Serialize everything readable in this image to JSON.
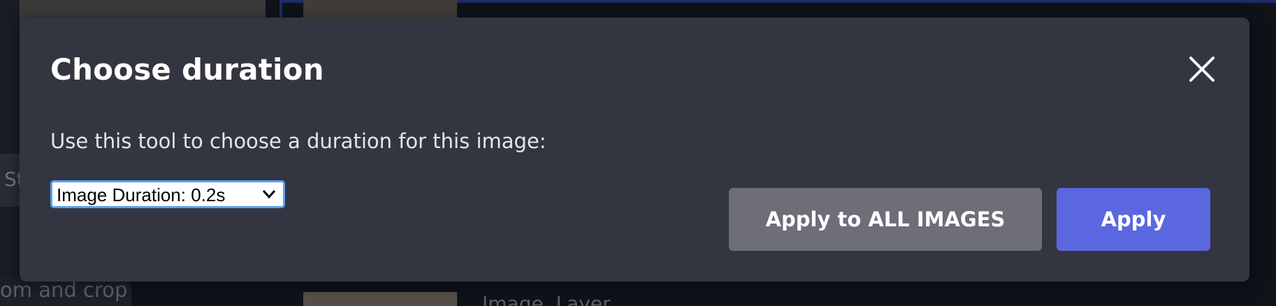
{
  "background": {
    "side_text": "St",
    "bottom_left_text": "om and crop",
    "bottom_label_text": "Image, Layer"
  },
  "modal": {
    "title": "Choose duration",
    "description": "Use this tool to choose a duration for this image:",
    "close_icon": "close-icon",
    "select": {
      "selected_value": "Image Duration: 0.2s"
    },
    "buttons": {
      "apply_all_label": "Apply to ALL IMAGES",
      "apply_label": "Apply"
    },
    "colors": {
      "modal_bg": "#333640",
      "apply_bg": "#5b67e0",
      "apply_all_bg": "#6d6e78",
      "focus_ring": "#5aa0f0"
    }
  }
}
